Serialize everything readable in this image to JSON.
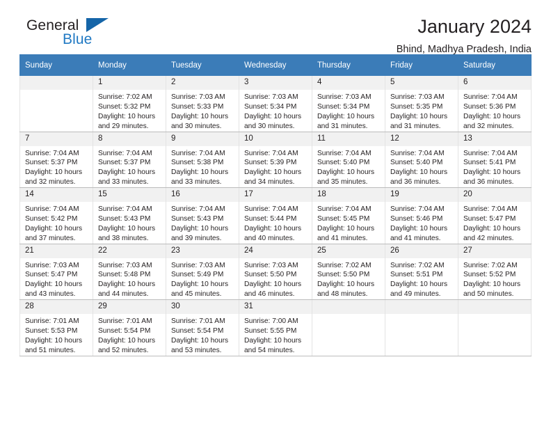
{
  "brand": {
    "name_top": "General",
    "name_bottom": "Blue",
    "triangle_icon": "triangle-flag-icon",
    "accent_color": "#2079c3"
  },
  "header": {
    "title": "January 2024",
    "subtitle": "Bhind, Madhya Pradesh, India"
  },
  "calendar": {
    "header_bg": "#3b7cb8",
    "daynum_bg": "#f1f1f1",
    "weekdays": [
      "Sunday",
      "Monday",
      "Tuesday",
      "Wednesday",
      "Thursday",
      "Friday",
      "Saturday"
    ],
    "weeks": [
      [
        {
          "day": "",
          "sunrise": "",
          "sunset": "",
          "daylight": ""
        },
        {
          "day": "1",
          "sunrise": "Sunrise: 7:02 AM",
          "sunset": "Sunset: 5:32 PM",
          "daylight": "Daylight: 10 hours and 29 minutes."
        },
        {
          "day": "2",
          "sunrise": "Sunrise: 7:03 AM",
          "sunset": "Sunset: 5:33 PM",
          "daylight": "Daylight: 10 hours and 30 minutes."
        },
        {
          "day": "3",
          "sunrise": "Sunrise: 7:03 AM",
          "sunset": "Sunset: 5:34 PM",
          "daylight": "Daylight: 10 hours and 30 minutes."
        },
        {
          "day": "4",
          "sunrise": "Sunrise: 7:03 AM",
          "sunset": "Sunset: 5:34 PM",
          "daylight": "Daylight: 10 hours and 31 minutes."
        },
        {
          "day": "5",
          "sunrise": "Sunrise: 7:03 AM",
          "sunset": "Sunset: 5:35 PM",
          "daylight": "Daylight: 10 hours and 31 minutes."
        },
        {
          "day": "6",
          "sunrise": "Sunrise: 7:04 AM",
          "sunset": "Sunset: 5:36 PM",
          "daylight": "Daylight: 10 hours and 32 minutes."
        }
      ],
      [
        {
          "day": "7",
          "sunrise": "Sunrise: 7:04 AM",
          "sunset": "Sunset: 5:37 PM",
          "daylight": "Daylight: 10 hours and 32 minutes."
        },
        {
          "day": "8",
          "sunrise": "Sunrise: 7:04 AM",
          "sunset": "Sunset: 5:37 PM",
          "daylight": "Daylight: 10 hours and 33 minutes."
        },
        {
          "day": "9",
          "sunrise": "Sunrise: 7:04 AM",
          "sunset": "Sunset: 5:38 PM",
          "daylight": "Daylight: 10 hours and 33 minutes."
        },
        {
          "day": "10",
          "sunrise": "Sunrise: 7:04 AM",
          "sunset": "Sunset: 5:39 PM",
          "daylight": "Daylight: 10 hours and 34 minutes."
        },
        {
          "day": "11",
          "sunrise": "Sunrise: 7:04 AM",
          "sunset": "Sunset: 5:40 PM",
          "daylight": "Daylight: 10 hours and 35 minutes."
        },
        {
          "day": "12",
          "sunrise": "Sunrise: 7:04 AM",
          "sunset": "Sunset: 5:40 PM",
          "daylight": "Daylight: 10 hours and 36 minutes."
        },
        {
          "day": "13",
          "sunrise": "Sunrise: 7:04 AM",
          "sunset": "Sunset: 5:41 PM",
          "daylight": "Daylight: 10 hours and 36 minutes."
        }
      ],
      [
        {
          "day": "14",
          "sunrise": "Sunrise: 7:04 AM",
          "sunset": "Sunset: 5:42 PM",
          "daylight": "Daylight: 10 hours and 37 minutes."
        },
        {
          "day": "15",
          "sunrise": "Sunrise: 7:04 AM",
          "sunset": "Sunset: 5:43 PM",
          "daylight": "Daylight: 10 hours and 38 minutes."
        },
        {
          "day": "16",
          "sunrise": "Sunrise: 7:04 AM",
          "sunset": "Sunset: 5:43 PM",
          "daylight": "Daylight: 10 hours and 39 minutes."
        },
        {
          "day": "17",
          "sunrise": "Sunrise: 7:04 AM",
          "sunset": "Sunset: 5:44 PM",
          "daylight": "Daylight: 10 hours and 40 minutes."
        },
        {
          "day": "18",
          "sunrise": "Sunrise: 7:04 AM",
          "sunset": "Sunset: 5:45 PM",
          "daylight": "Daylight: 10 hours and 41 minutes."
        },
        {
          "day": "19",
          "sunrise": "Sunrise: 7:04 AM",
          "sunset": "Sunset: 5:46 PM",
          "daylight": "Daylight: 10 hours and 41 minutes."
        },
        {
          "day": "20",
          "sunrise": "Sunrise: 7:04 AM",
          "sunset": "Sunset: 5:47 PM",
          "daylight": "Daylight: 10 hours and 42 minutes."
        }
      ],
      [
        {
          "day": "21",
          "sunrise": "Sunrise: 7:03 AM",
          "sunset": "Sunset: 5:47 PM",
          "daylight": "Daylight: 10 hours and 43 minutes."
        },
        {
          "day": "22",
          "sunrise": "Sunrise: 7:03 AM",
          "sunset": "Sunset: 5:48 PM",
          "daylight": "Daylight: 10 hours and 44 minutes."
        },
        {
          "day": "23",
          "sunrise": "Sunrise: 7:03 AM",
          "sunset": "Sunset: 5:49 PM",
          "daylight": "Daylight: 10 hours and 45 minutes."
        },
        {
          "day": "24",
          "sunrise": "Sunrise: 7:03 AM",
          "sunset": "Sunset: 5:50 PM",
          "daylight": "Daylight: 10 hours and 46 minutes."
        },
        {
          "day": "25",
          "sunrise": "Sunrise: 7:02 AM",
          "sunset": "Sunset: 5:50 PM",
          "daylight": "Daylight: 10 hours and 48 minutes."
        },
        {
          "day": "26",
          "sunrise": "Sunrise: 7:02 AM",
          "sunset": "Sunset: 5:51 PM",
          "daylight": "Daylight: 10 hours and 49 minutes."
        },
        {
          "day": "27",
          "sunrise": "Sunrise: 7:02 AM",
          "sunset": "Sunset: 5:52 PM",
          "daylight": "Daylight: 10 hours and 50 minutes."
        }
      ],
      [
        {
          "day": "28",
          "sunrise": "Sunrise: 7:01 AM",
          "sunset": "Sunset: 5:53 PM",
          "daylight": "Daylight: 10 hours and 51 minutes."
        },
        {
          "day": "29",
          "sunrise": "Sunrise: 7:01 AM",
          "sunset": "Sunset: 5:54 PM",
          "daylight": "Daylight: 10 hours and 52 minutes."
        },
        {
          "day": "30",
          "sunrise": "Sunrise: 7:01 AM",
          "sunset": "Sunset: 5:54 PM",
          "daylight": "Daylight: 10 hours and 53 minutes."
        },
        {
          "day": "31",
          "sunrise": "Sunrise: 7:00 AM",
          "sunset": "Sunset: 5:55 PM",
          "daylight": "Daylight: 10 hours and 54 minutes."
        },
        {
          "day": "",
          "sunrise": "",
          "sunset": "",
          "daylight": ""
        },
        {
          "day": "",
          "sunrise": "",
          "sunset": "",
          "daylight": ""
        },
        {
          "day": "",
          "sunrise": "",
          "sunset": "",
          "daylight": ""
        }
      ]
    ]
  }
}
